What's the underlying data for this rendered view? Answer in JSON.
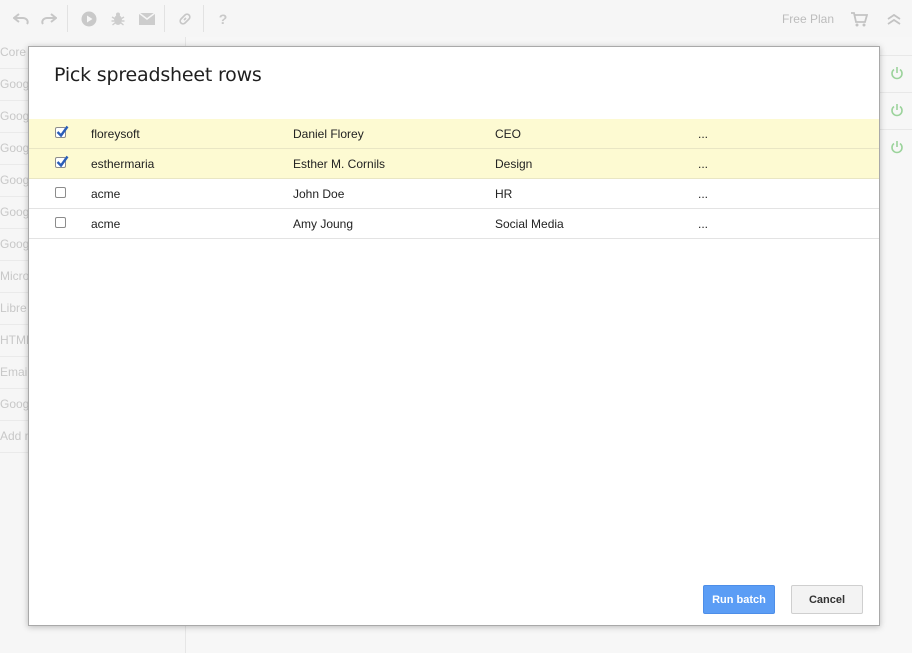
{
  "toolbar": {
    "icons": [
      "undo-icon",
      "redo-icon",
      "play-icon",
      "bug-icon",
      "mail-icon",
      "link-icon",
      "help-icon"
    ],
    "help_label": "?",
    "plan_label": "Free Plan"
  },
  "sidebar": {
    "items": [
      {
        "label": "Core"
      },
      {
        "label": "Goog"
      },
      {
        "label": "Goog"
      },
      {
        "label": "Goog"
      },
      {
        "label": "Goog"
      },
      {
        "label": "Goog"
      },
      {
        "label": "Goog"
      },
      {
        "label": "Micro"
      },
      {
        "label": "Libre"
      },
      {
        "label": "HTML"
      },
      {
        "label": "Email"
      },
      {
        "label": "Goog"
      },
      {
        "label": "Add n"
      }
    ]
  },
  "modal": {
    "title": "Pick spreadsheet rows",
    "rows": [
      {
        "checked": true,
        "c1": "floreysoft",
        "c2": "Daniel Florey",
        "c3": "CEO",
        "c4": "..."
      },
      {
        "checked": true,
        "c1": "esthermaria",
        "c2": "Esther M. Cornils",
        "c3": "Design",
        "c4": "..."
      },
      {
        "checked": false,
        "c1": "acme",
        "c2": "John Doe",
        "c3": "HR",
        "c4": "..."
      },
      {
        "checked": false,
        "c1": "acme",
        "c2": "Amy Joung",
        "c3": "Social Media",
        "c4": "..."
      }
    ],
    "run_label": "Run batch",
    "cancel_label": "Cancel"
  },
  "colors": {
    "accent": "#5b9df5",
    "checked_row": "#fdfad2",
    "power_icon": "#9bd39b"
  }
}
